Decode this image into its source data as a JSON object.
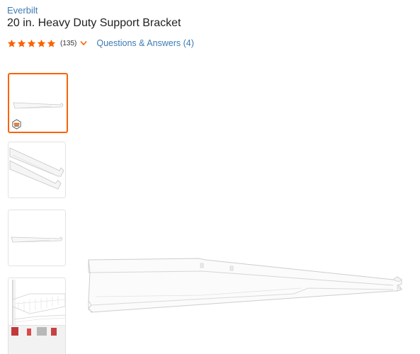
{
  "product": {
    "brand": "Everbilt",
    "title": "20 in. Heavy Duty Support Bracket",
    "rating": 5,
    "review_count": "(135)",
    "qa_link": "Questions & Answers (4)"
  },
  "colors": {
    "accent": "#f96302",
    "link": "#3e7bb6",
    "star": "#f96302"
  },
  "icons": {
    "star": "star-icon",
    "chevron": "chevron-down-icon",
    "badge": "product-badge-icon"
  },
  "thumbnails": [
    {
      "name": "thumb-bracket-side",
      "selected": true
    },
    {
      "name": "thumb-bracket-angle",
      "selected": false
    },
    {
      "name": "thumb-bracket-plain",
      "selected": false
    },
    {
      "name": "thumb-shelf-installed",
      "selected": false
    },
    {
      "name": "thumb-room-scene",
      "selected": false
    }
  ]
}
